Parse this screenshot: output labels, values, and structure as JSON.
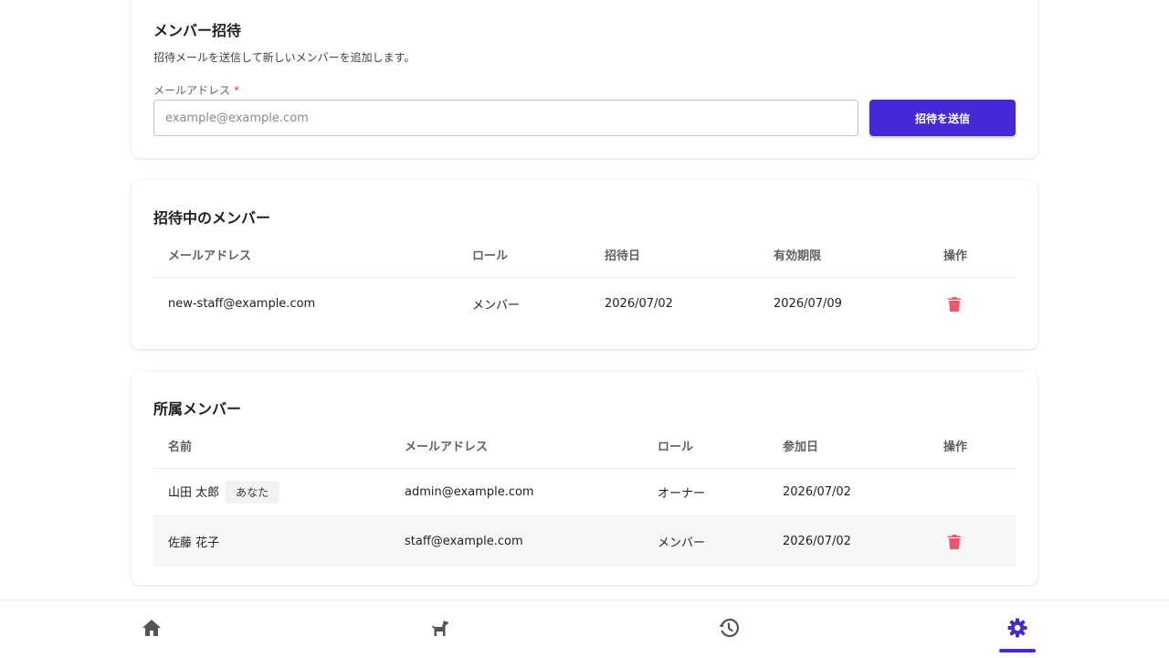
{
  "invite": {
    "title": "メンバー招待",
    "subtitle": "招待メールを送信して新しいメンバーを追加します。",
    "email_label": "メールアドレス",
    "required_mark": "*",
    "email_placeholder": "example@example.com",
    "email_value": "",
    "send_label": "招待を送信"
  },
  "pending": {
    "title": "招待中のメンバー",
    "columns": [
      "メールアドレス",
      "ロール",
      "招待日",
      "有効期限",
      "操作"
    ],
    "rows": [
      {
        "email": "new-staff@example.com",
        "role": "メンバー",
        "invited": "2026/07/02",
        "expires": "2026/07/09",
        "action_icon": "trash-icon"
      }
    ]
  },
  "members": {
    "title": "所属メンバー",
    "columns": [
      "名前",
      "メールアドレス",
      "ロール",
      "参加日",
      "操作"
    ],
    "rows": [
      {
        "name": "山田 太郎",
        "badge": "あなた",
        "email": "admin@example.com",
        "role": "オーナー",
        "joined": "2026/07/02"
      },
      {
        "name": "佐藤 花子",
        "email": "staff@example.com",
        "role": "メンバー",
        "joined": "2026/07/02",
        "action_icon": "trash-icon"
      }
    ]
  },
  "nav": {
    "items": [
      {
        "icon": "home-icon"
      },
      {
        "icon": "dog-icon"
      },
      {
        "icon": "history-icon"
      },
      {
        "icon": "settings-icon",
        "active": true
      }
    ]
  },
  "colors": {
    "accent": "#4529d6",
    "delete": "#f0566b",
    "icon_gray": "#555555"
  }
}
